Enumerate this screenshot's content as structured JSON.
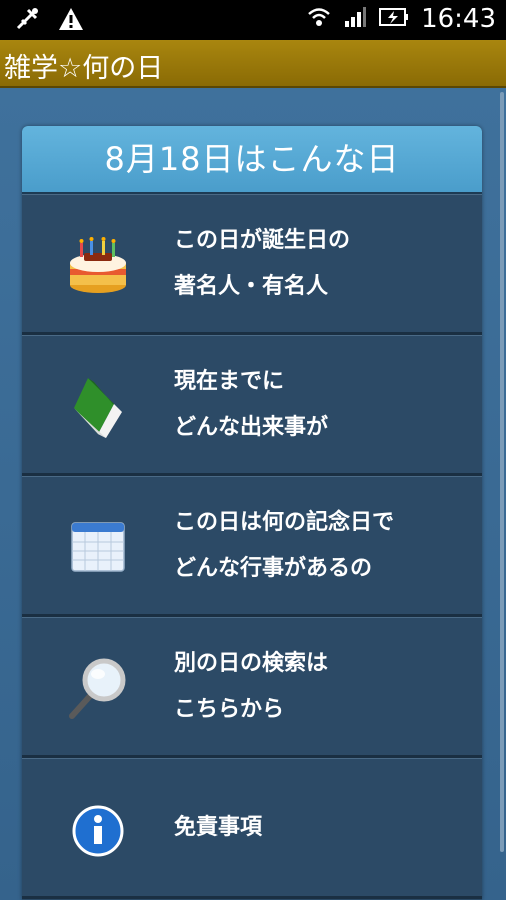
{
  "status_bar": {
    "time": "16:43",
    "icons": [
      "usb-debug-icon",
      "warning-icon",
      "wifi-icon",
      "signal-icon",
      "battery-charging-icon"
    ]
  },
  "app": {
    "title": "雑学☆何の日"
  },
  "card": {
    "header": "8月18日はこんな日"
  },
  "menu": [
    {
      "icon": "birthday-cake-icon",
      "line1": "この日が誕生日の",
      "line2": "著名人・有名人"
    },
    {
      "icon": "green-book-icon",
      "line1": "現在までに",
      "line2": "どんな出来事が"
    },
    {
      "icon": "calendar-icon",
      "line1": "この日は何の記念日で",
      "line2": "どんな行事があるの"
    },
    {
      "icon": "magnifier-icon",
      "line1": "別の日の検索は",
      "line2": "こちらから"
    },
    {
      "icon": "info-icon",
      "line1": "免責事項",
      "line2": ""
    }
  ]
}
